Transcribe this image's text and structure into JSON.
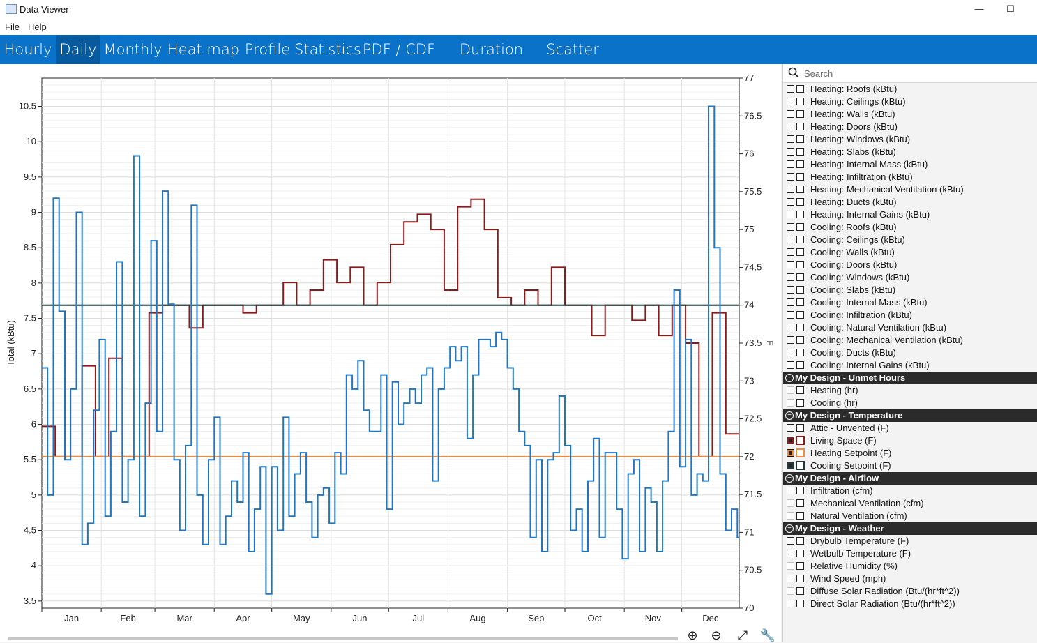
{
  "window": {
    "title": "Data Viewer",
    "minimize_glyph": "—",
    "maximize_glyph": "☐"
  },
  "menu": [
    "File",
    "Help"
  ],
  "tabs": [
    "Hourly",
    "Daily",
    "Monthly",
    "Heat map",
    "Profile",
    "Statistics",
    "PDF / CDF",
    "Duration curve",
    "Scatter"
  ],
  "active_tab": "Daily",
  "search": {
    "placeholder": "Search",
    "icon": "search-icon"
  },
  "variables": [
    {
      "type": "item",
      "label": "Heating: Roofs (kBtu)",
      "a": "empty",
      "b": "empty"
    },
    {
      "type": "item",
      "label": "Heating: Ceilings (kBtu)",
      "a": "empty",
      "b": "empty"
    },
    {
      "type": "item",
      "label": "Heating: Walls (kBtu)",
      "a": "empty",
      "b": "empty"
    },
    {
      "type": "item",
      "label": "Heating: Doors (kBtu)",
      "a": "empty",
      "b": "empty"
    },
    {
      "type": "item",
      "label": "Heating: Windows (kBtu)",
      "a": "empty",
      "b": "empty"
    },
    {
      "type": "item",
      "label": "Heating: Slabs (kBtu)",
      "a": "empty",
      "b": "empty"
    },
    {
      "type": "item",
      "label": "Heating: Internal Mass (kBtu)",
      "a": "empty",
      "b": "empty"
    },
    {
      "type": "item",
      "label": "Heating: Infiltration (kBtu)",
      "a": "empty",
      "b": "empty"
    },
    {
      "type": "item",
      "label": "Heating: Mechanical Ventilation (kBtu)",
      "a": "empty",
      "b": "empty"
    },
    {
      "type": "item",
      "label": "Heating: Ducts (kBtu)",
      "a": "empty",
      "b": "empty"
    },
    {
      "type": "item",
      "label": "Heating: Internal Gains (kBtu)",
      "a": "empty",
      "b": "empty"
    },
    {
      "type": "item",
      "label": "Cooling: Roofs (kBtu)",
      "a": "empty",
      "b": "empty"
    },
    {
      "type": "item",
      "label": "Cooling: Ceilings (kBtu)",
      "a": "empty",
      "b": "empty"
    },
    {
      "type": "item",
      "label": "Cooling: Walls (kBtu)",
      "a": "empty",
      "b": "empty"
    },
    {
      "type": "item",
      "label": "Cooling: Doors (kBtu)",
      "a": "empty",
      "b": "empty"
    },
    {
      "type": "item",
      "label": "Cooling: Windows (kBtu)",
      "a": "empty",
      "b": "empty"
    },
    {
      "type": "item",
      "label": "Cooling: Slabs (kBtu)",
      "a": "empty",
      "b": "empty"
    },
    {
      "type": "item",
      "label": "Cooling: Internal Mass (kBtu)",
      "a": "empty",
      "b": "empty"
    },
    {
      "type": "item",
      "label": "Cooling: Infiltration (kBtu)",
      "a": "empty",
      "b": "empty"
    },
    {
      "type": "item",
      "label": "Cooling: Natural Ventilation (kBtu)",
      "a": "empty",
      "b": "empty"
    },
    {
      "type": "item",
      "label": "Cooling: Mechanical Ventilation (kBtu)",
      "a": "empty",
      "b": "empty"
    },
    {
      "type": "item",
      "label": "Cooling: Ducts (kBtu)",
      "a": "empty",
      "b": "empty"
    },
    {
      "type": "item",
      "label": "Cooling: Internal Gains (kBtu)",
      "a": "empty",
      "b": "empty"
    },
    {
      "type": "group",
      "label": "My Design - Unmet Hours"
    },
    {
      "type": "item",
      "label": "Heating (hr)",
      "a": "faint",
      "b": "empty"
    },
    {
      "type": "item",
      "label": "Cooling (hr)",
      "a": "faint",
      "b": "empty"
    },
    {
      "type": "group",
      "label": "My Design - Temperature"
    },
    {
      "type": "item",
      "label": "Attic - Unvented (F)",
      "a": "empty",
      "b": "empty"
    },
    {
      "type": "item",
      "label": "Living Space (F)",
      "a": "filled",
      "b": "empty",
      "color": "#8b1a1a"
    },
    {
      "type": "item",
      "label": "Heating Setpoint (F)",
      "a": "filled",
      "b": "empty",
      "color": "#f08c3c"
    },
    {
      "type": "item",
      "label": "Cooling Setpoint (F)",
      "a": "filled",
      "b": "empty",
      "color": "#1f3a3a"
    },
    {
      "type": "group",
      "label": "My Design - Airflow"
    },
    {
      "type": "item",
      "label": "Infiltration (cfm)",
      "a": "faint",
      "b": "empty"
    },
    {
      "type": "item",
      "label": "Mechanical Ventilation (cfm)",
      "a": "faint",
      "b": "empty"
    },
    {
      "type": "item",
      "label": "Natural Ventilation (cfm)",
      "a": "faint",
      "b": "empty"
    },
    {
      "type": "group",
      "label": "My Design - Weather"
    },
    {
      "type": "item",
      "label": "Drybulb Temperature (F)",
      "a": "empty",
      "b": "empty"
    },
    {
      "type": "item",
      "label": "Wetbulb Temperature (F)",
      "a": "empty",
      "b": "empty"
    },
    {
      "type": "item",
      "label": "Relative Humidity (%)",
      "a": "faint",
      "b": "empty"
    },
    {
      "type": "item",
      "label": "Wind Speed (mph)",
      "a": "faint",
      "b": "empty"
    },
    {
      "type": "item",
      "label": "Diffuse Solar Radiation (Btu/(hr*ft^2))",
      "a": "faint",
      "b": "empty"
    },
    {
      "type": "item",
      "label": "Direct Solar Radiation (Btu/(hr*ft^2))",
      "a": "faint",
      "b": "empty"
    }
  ],
  "toolbar_icons": [
    "zoom-in-icon",
    "zoom-out-icon",
    "fit-icon",
    "settings-wrench-icon"
  ],
  "chart_data": {
    "type": "line",
    "ylabel": "Total (kBtu)",
    "y2label": "F",
    "ylim": [
      3.4,
      10.9
    ],
    "y2lim": [
      70,
      77
    ],
    "yticks": [
      3.5,
      4,
      4.5,
      5,
      5.5,
      6,
      6.5,
      7,
      7.5,
      8,
      8.5,
      9,
      9.5,
      10,
      10.5
    ],
    "y2ticks": [
      70,
      70.5,
      71,
      71.5,
      72,
      72.5,
      73,
      73.5,
      74,
      74.5,
      75,
      75.5,
      76,
      76.5,
      77
    ],
    "months": [
      "Jan",
      "Feb",
      "Mar",
      "Apr",
      "May",
      "Jun",
      "Jul",
      "Aug",
      "Sep",
      "Oct",
      "Nov",
      "Dec"
    ],
    "xlim": [
      1,
      365
    ],
    "grid": true,
    "step": true,
    "series": [
      {
        "name": "Living Space (F)",
        "axis": "right",
        "color": "#8b1a1a",
        "x": [
          1,
          8,
          15,
          22,
          29,
          36,
          43,
          50,
          57,
          64,
          71,
          78,
          85,
          92,
          99,
          106,
          113,
          120,
          127,
          134,
          141,
          148,
          155,
          162,
          169,
          176,
          183,
          190,
          197,
          204,
          211,
          218,
          225,
          232,
          239,
          246,
          253,
          260,
          267,
          274,
          281,
          288,
          295,
          302,
          309,
          316,
          323,
          330,
          337,
          344,
          351,
          358,
          365
        ],
        "y": [
          72.4,
          72.0,
          72.0,
          73.2,
          72.0,
          73.3,
          72.0,
          72.0,
          73.9,
          74.0,
          74.0,
          73.7,
          74.0,
          74.0,
          74.0,
          73.9,
          74.0,
          74.0,
          74.3,
          74.0,
          74.2,
          74.6,
          74.3,
          74.5,
          74.0,
          74.3,
          74.8,
          75.1,
          75.2,
          75.0,
          74.2,
          75.3,
          75.4,
          75.0,
          74.1,
          74.0,
          74.2,
          74.0,
          74.5,
          74.0,
          74.0,
          73.6,
          74.0,
          74.0,
          73.8,
          74.0,
          73.6,
          74.0,
          73.5,
          72.0,
          73.9,
          72.3,
          74.0
        ]
      },
      {
        "name": "Heating Setpoint (F)",
        "axis": "right",
        "color": "#f08c3c",
        "x": [
          1,
          365
        ],
        "y": [
          72,
          72
        ]
      },
      {
        "name": "Cooling Setpoint (F)",
        "axis": "right",
        "color": "#1f3a3a",
        "x": [
          1,
          365
        ],
        "y": [
          74,
          74
        ]
      },
      {
        "name": "Total (kBtu)",
        "axis": "left",
        "color": "#1f77c4",
        "x": [
          1,
          4,
          7,
          10,
          13,
          16,
          19,
          22,
          25,
          28,
          31,
          34,
          37,
          40,
          43,
          46,
          49,
          52,
          55,
          58,
          61,
          64,
          67,
          70,
          73,
          76,
          79,
          82,
          85,
          88,
          91,
          94,
          97,
          100,
          103,
          106,
          109,
          112,
          115,
          118,
          121,
          124,
          127,
          130,
          133,
          136,
          139,
          142,
          145,
          148,
          151,
          154,
          157,
          160,
          163,
          166,
          169,
          172,
          175,
          178,
          181,
          184,
          187,
          190,
          193,
          196,
          199,
          202,
          205,
          208,
          211,
          214,
          217,
          220,
          223,
          226,
          229,
          232,
          235,
          238,
          241,
          244,
          247,
          250,
          253,
          256,
          259,
          262,
          265,
          268,
          271,
          274,
          277,
          280,
          283,
          286,
          289,
          292,
          295,
          298,
          301,
          304,
          307,
          310,
          313,
          316,
          319,
          322,
          325,
          328,
          331,
          334,
          337,
          340,
          343,
          346,
          349,
          352,
          355,
          358,
          361,
          364
        ],
        "y": [
          6.8,
          5.0,
          9.2,
          7.6,
          5.5,
          6.5,
          9.0,
          4.3,
          4.6,
          6.2,
          7.2,
          4.7,
          5.9,
          8.3,
          4.9,
          5.5,
          9.8,
          4.7,
          6.3,
          8.6,
          5.9,
          9.3,
          7.7,
          5.5,
          4.5,
          5.7,
          9.1,
          5.0,
          4.3,
          5.5,
          6.1,
          4.3,
          4.7,
          5.2,
          4.9,
          5.6,
          4.2,
          4.8,
          5.4,
          3.6,
          5.4,
          4.5,
          6.1,
          4.7,
          5.3,
          5.6,
          4.9,
          4.4,
          5.0,
          5.1,
          4.6,
          5.6,
          5.3,
          6.7,
          6.5,
          6.9,
          6.2,
          5.9,
          5.9,
          6.7,
          4.8,
          6.6,
          6.0,
          6.3,
          6.5,
          6.3,
          6.7,
          6.8,
          5.2,
          6.5,
          6.8,
          7.1,
          6.9,
          7.1,
          5.8,
          6.7,
          7.2,
          7.2,
          7.1,
          7.3,
          7.2,
          6.8,
          6.5,
          5.9,
          5.7,
          4.4,
          5.5,
          4.2,
          5.5,
          5.6,
          6.4,
          5.7,
          4.5,
          4.8,
          4.2,
          5.2,
          5.8,
          4.4,
          5.6,
          5.6,
          4.8,
          4.1,
          5.3,
          5.5,
          4.2,
          5.1,
          4.9,
          4.2,
          5.2,
          5.9,
          7.9,
          5.4,
          7.2,
          5.0,
          5.3,
          5.2,
          10.5,
          8.5,
          5.3,
          4.5,
          4.8,
          4.4
        ]
      }
    ]
  }
}
